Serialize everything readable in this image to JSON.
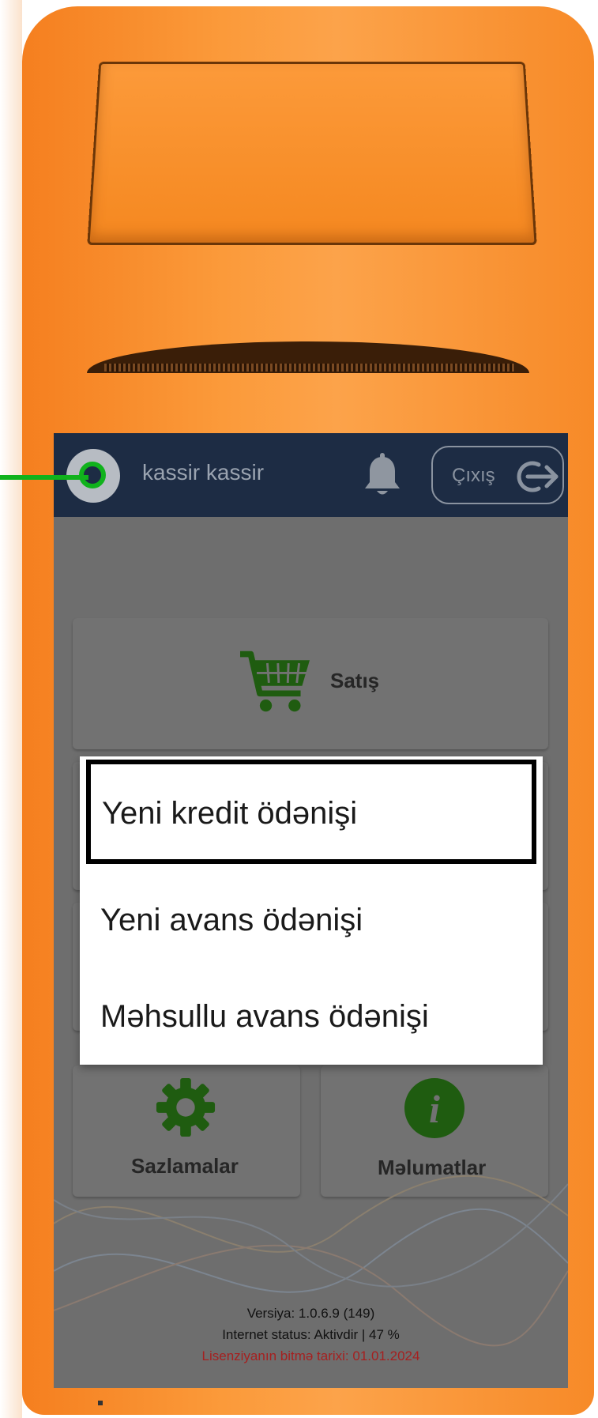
{
  "header": {
    "username": "kassir kassir",
    "logout_label": "Çıxış"
  },
  "tiles": {
    "sales_label": "Satış",
    "settings_label": "Sazlamalar",
    "info_label": "Məlumatlar"
  },
  "popup_menu": {
    "items": [
      "Yeni kredit ödənişi",
      "Yeni avans ödənişi",
      "Məhsullu avans ödənişi"
    ],
    "focused_index": 0
  },
  "footer": {
    "version": "Versiya: 1.0.6.9 (149)",
    "internet_status": "Internet status: Aktivdir | 47 %",
    "license_expiry": "Lisenziyanın bitmə tarixi: 01.01.2024"
  },
  "icons": {
    "avatar": "user-avatar-icon",
    "bell": "bell-icon",
    "logout": "logout-arrow-icon",
    "cart": "shopping-cart-icon",
    "gear": "gear-icon",
    "info": "info-icon"
  },
  "colors": {
    "device_body": "#f78a28",
    "topbar": "#1d2c44",
    "icon_green": "#1f5c10",
    "pointer": "#10b21c",
    "license_text": "#a52020"
  }
}
